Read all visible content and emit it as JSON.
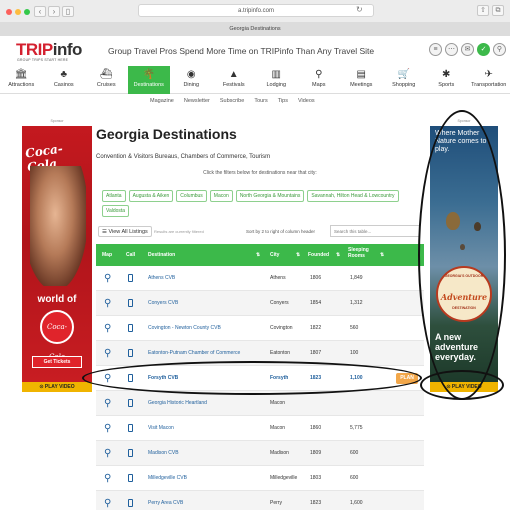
{
  "browser": {
    "url": "a.tripinfo.com",
    "tab_title": "Georgia Destinations"
  },
  "header": {
    "logo_trip": "TRIP",
    "logo_info": "info",
    "logo_sub": "GROUP TRIPS START HERE",
    "tagline": "Group Travel Pros Spend More Time on TRIPinfo Than Any Travel Site"
  },
  "nav": {
    "items": [
      {
        "label": "Attractions",
        "icon": "🏛"
      },
      {
        "label": "Casinos",
        "icon": "♣"
      },
      {
        "label": "Cruises",
        "icon": "⛴"
      },
      {
        "label": "Destinations",
        "icon": "🌴"
      },
      {
        "label": "Dining",
        "icon": "◉"
      },
      {
        "label": "Festivals",
        "icon": "▲"
      },
      {
        "label": "Lodging",
        "icon": "▥"
      },
      {
        "label": "Maps",
        "icon": "⚲"
      },
      {
        "label": "Meetings",
        "icon": "▤"
      },
      {
        "label": "Shopping",
        "icon": "🛒"
      },
      {
        "label": "Sports",
        "icon": "✱"
      },
      {
        "label": "Transportation",
        "icon": "✈"
      }
    ],
    "active": "Destinations"
  },
  "subnav": [
    "Magazine",
    "Newsletter",
    "Subscribe",
    "Tours",
    "Tips",
    "Videos"
  ],
  "ads": {
    "sponsor_label": "Sponsor",
    "left": {
      "brand": "Coca-Cola",
      "headline": "world of",
      "badge": "Coca-Cola",
      "cta": "Get Tickets",
      "play": "⊙ PLAY VIDEO"
    },
    "right": {
      "text_top": "Where Mother Nature comes to play.",
      "seal_top": "GEORGIA'S OUTDOOR",
      "seal_mid": "Adventure",
      "seal_bottom": "DESTINATION",
      "text_bottom": "A new adventure everyday.",
      "play": "⊙ PLAY VIDEO"
    }
  },
  "main": {
    "title": "Georgia Destinations",
    "subtitle": "Convention & Visitors Bureaus, Chambers of Commerce, Tourism",
    "filter_hint": "Click the filters below for destinations near that city:",
    "filters": [
      "Atlanta",
      "Augusta & Aiken",
      "Columbus",
      "Macon",
      "North Georgia & Mountains",
      "Savannah, Hilton Head & Lowcountry",
      "Valdosta"
    ],
    "view_all": "☰ View All Listings",
    "filtered_note": "Results are currently filtered",
    "sort_note": "Sort by 2 to right of column header",
    "search_placeholder": "Search this table..."
  },
  "table": {
    "headers": {
      "map": "Map",
      "call": "Call",
      "destination": "Destination",
      "city": "City",
      "founded": "Founded",
      "rooms": "Sleeping Rooms"
    },
    "rows": [
      {
        "destination": "Athens CVB",
        "city": "Athens",
        "founded": "1806",
        "rooms": "1,849",
        "plan": ""
      },
      {
        "destination": "Conyers CVB",
        "city": "Conyers",
        "founded": "1854",
        "rooms": "1,312",
        "plan": ""
      },
      {
        "destination": "Covington - Newton County CVB",
        "city": "Covington",
        "founded": "1822",
        "rooms": "560",
        "plan": ""
      },
      {
        "destination": "Eatonton-Putnam Chamber of Commerce",
        "city": "Eatonton",
        "founded": "1807",
        "rooms": "100",
        "plan": ""
      },
      {
        "destination": "Forsyth CVB",
        "city": "Forsyth",
        "founded": "1823",
        "rooms": "1,100",
        "plan": "PLAN"
      },
      {
        "destination": "Georgia Historic Heartland",
        "city": "Macon",
        "founded": "",
        "rooms": "",
        "plan": ""
      },
      {
        "destination": "Visit Macon",
        "city": "Macon",
        "founded": "1860",
        "rooms": "5,775",
        "plan": ""
      },
      {
        "destination": "Madison CVB",
        "city": "Madison",
        "founded": "1809",
        "rooms": "600",
        "plan": ""
      },
      {
        "destination": "Milledgeville CVB",
        "city": "Milledgeville",
        "founded": "1803",
        "rooms": "600",
        "plan": ""
      },
      {
        "destination": "Perry Area CVB",
        "city": "Perry",
        "founded": "1823",
        "rooms": "1,600",
        "plan": ""
      }
    ]
  },
  "colors": {
    "accent": "#3cb94a",
    "brand_red": "#d4202f",
    "link": "#1f5f9c",
    "plan": "#f2a74a"
  }
}
